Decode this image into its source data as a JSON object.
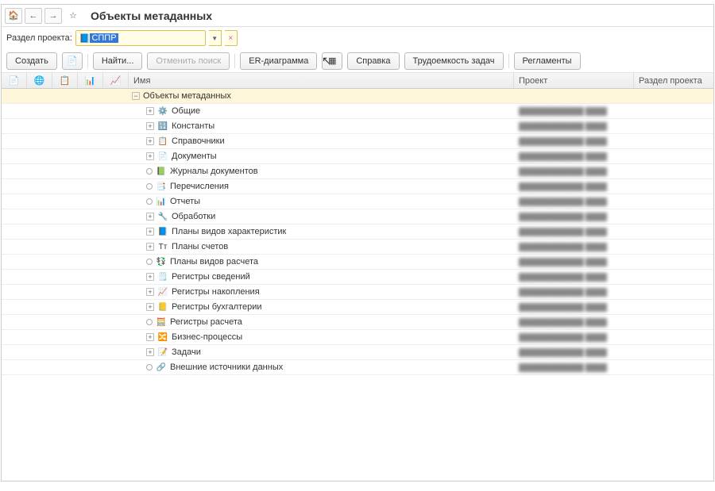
{
  "title": "Объекты метаданных",
  "filter": {
    "label": "Раздел проекта:",
    "value": "СППР"
  },
  "toolbar": {
    "create": "Создать",
    "find": "Найти...",
    "cancel_search": "Отменить поиск",
    "er_diagram": "ER-диаграмма",
    "help": "Справка",
    "labor": "Трудоемкость задач",
    "reglaments": "Регламенты"
  },
  "columns": {
    "name": "Имя",
    "project": "Проект",
    "section": "Раздел проекта"
  },
  "root": {
    "label": "Объекты метаданных"
  },
  "items": [
    {
      "label": "Общие",
      "exp": "plus",
      "icon": "⚙️",
      "proj": "████████████ ████"
    },
    {
      "label": "Константы",
      "exp": "plus",
      "icon": "🔢",
      "proj": "████████████ ████"
    },
    {
      "label": "Справочники",
      "exp": "plus",
      "icon": "📋",
      "proj": "████████████ ████"
    },
    {
      "label": "Документы",
      "exp": "plus",
      "icon": "📄",
      "proj": "████████████ ████"
    },
    {
      "label": "Журналы документов",
      "exp": "circ",
      "icon": "📗",
      "proj": "████████████ ████"
    },
    {
      "label": "Перечисления",
      "exp": "circ",
      "icon": "📑",
      "proj": "████████████ ████"
    },
    {
      "label": "Отчеты",
      "exp": "circ",
      "icon": "📊",
      "proj": "████████████ ████"
    },
    {
      "label": "Обработки",
      "exp": "plus",
      "icon": "🔧",
      "proj": "████████████ ████"
    },
    {
      "label": "Планы видов характеристик",
      "exp": "plus",
      "icon": "📘",
      "proj": "████████████ ████"
    },
    {
      "label": "Планы счетов",
      "exp": "plus",
      "icon": "Тт",
      "proj": "████████████ ████"
    },
    {
      "label": "Планы видов расчета",
      "exp": "circ",
      "icon": "💱",
      "proj": "████████████ ████"
    },
    {
      "label": "Регистры сведений",
      "exp": "plus",
      "icon": "🗒️",
      "proj": "████████████ ████"
    },
    {
      "label": "Регистры накопления",
      "exp": "plus",
      "icon": "📈",
      "proj": "████████████ ████"
    },
    {
      "label": "Регистры бухгалтерии",
      "exp": "plus",
      "icon": "📒",
      "proj": "████████████ ████"
    },
    {
      "label": "Регистры расчета",
      "exp": "circ",
      "icon": "🧮",
      "proj": "████████████ ████"
    },
    {
      "label": "Бизнес-процессы",
      "exp": "plus",
      "icon": "🔀",
      "proj": "████████████ ████"
    },
    {
      "label": "Задачи",
      "exp": "plus",
      "icon": "📝",
      "proj": "████████████ ████"
    },
    {
      "label": "Внешние источники данных",
      "exp": "circ",
      "icon": "🔗",
      "proj": "████████████ ████"
    }
  ]
}
